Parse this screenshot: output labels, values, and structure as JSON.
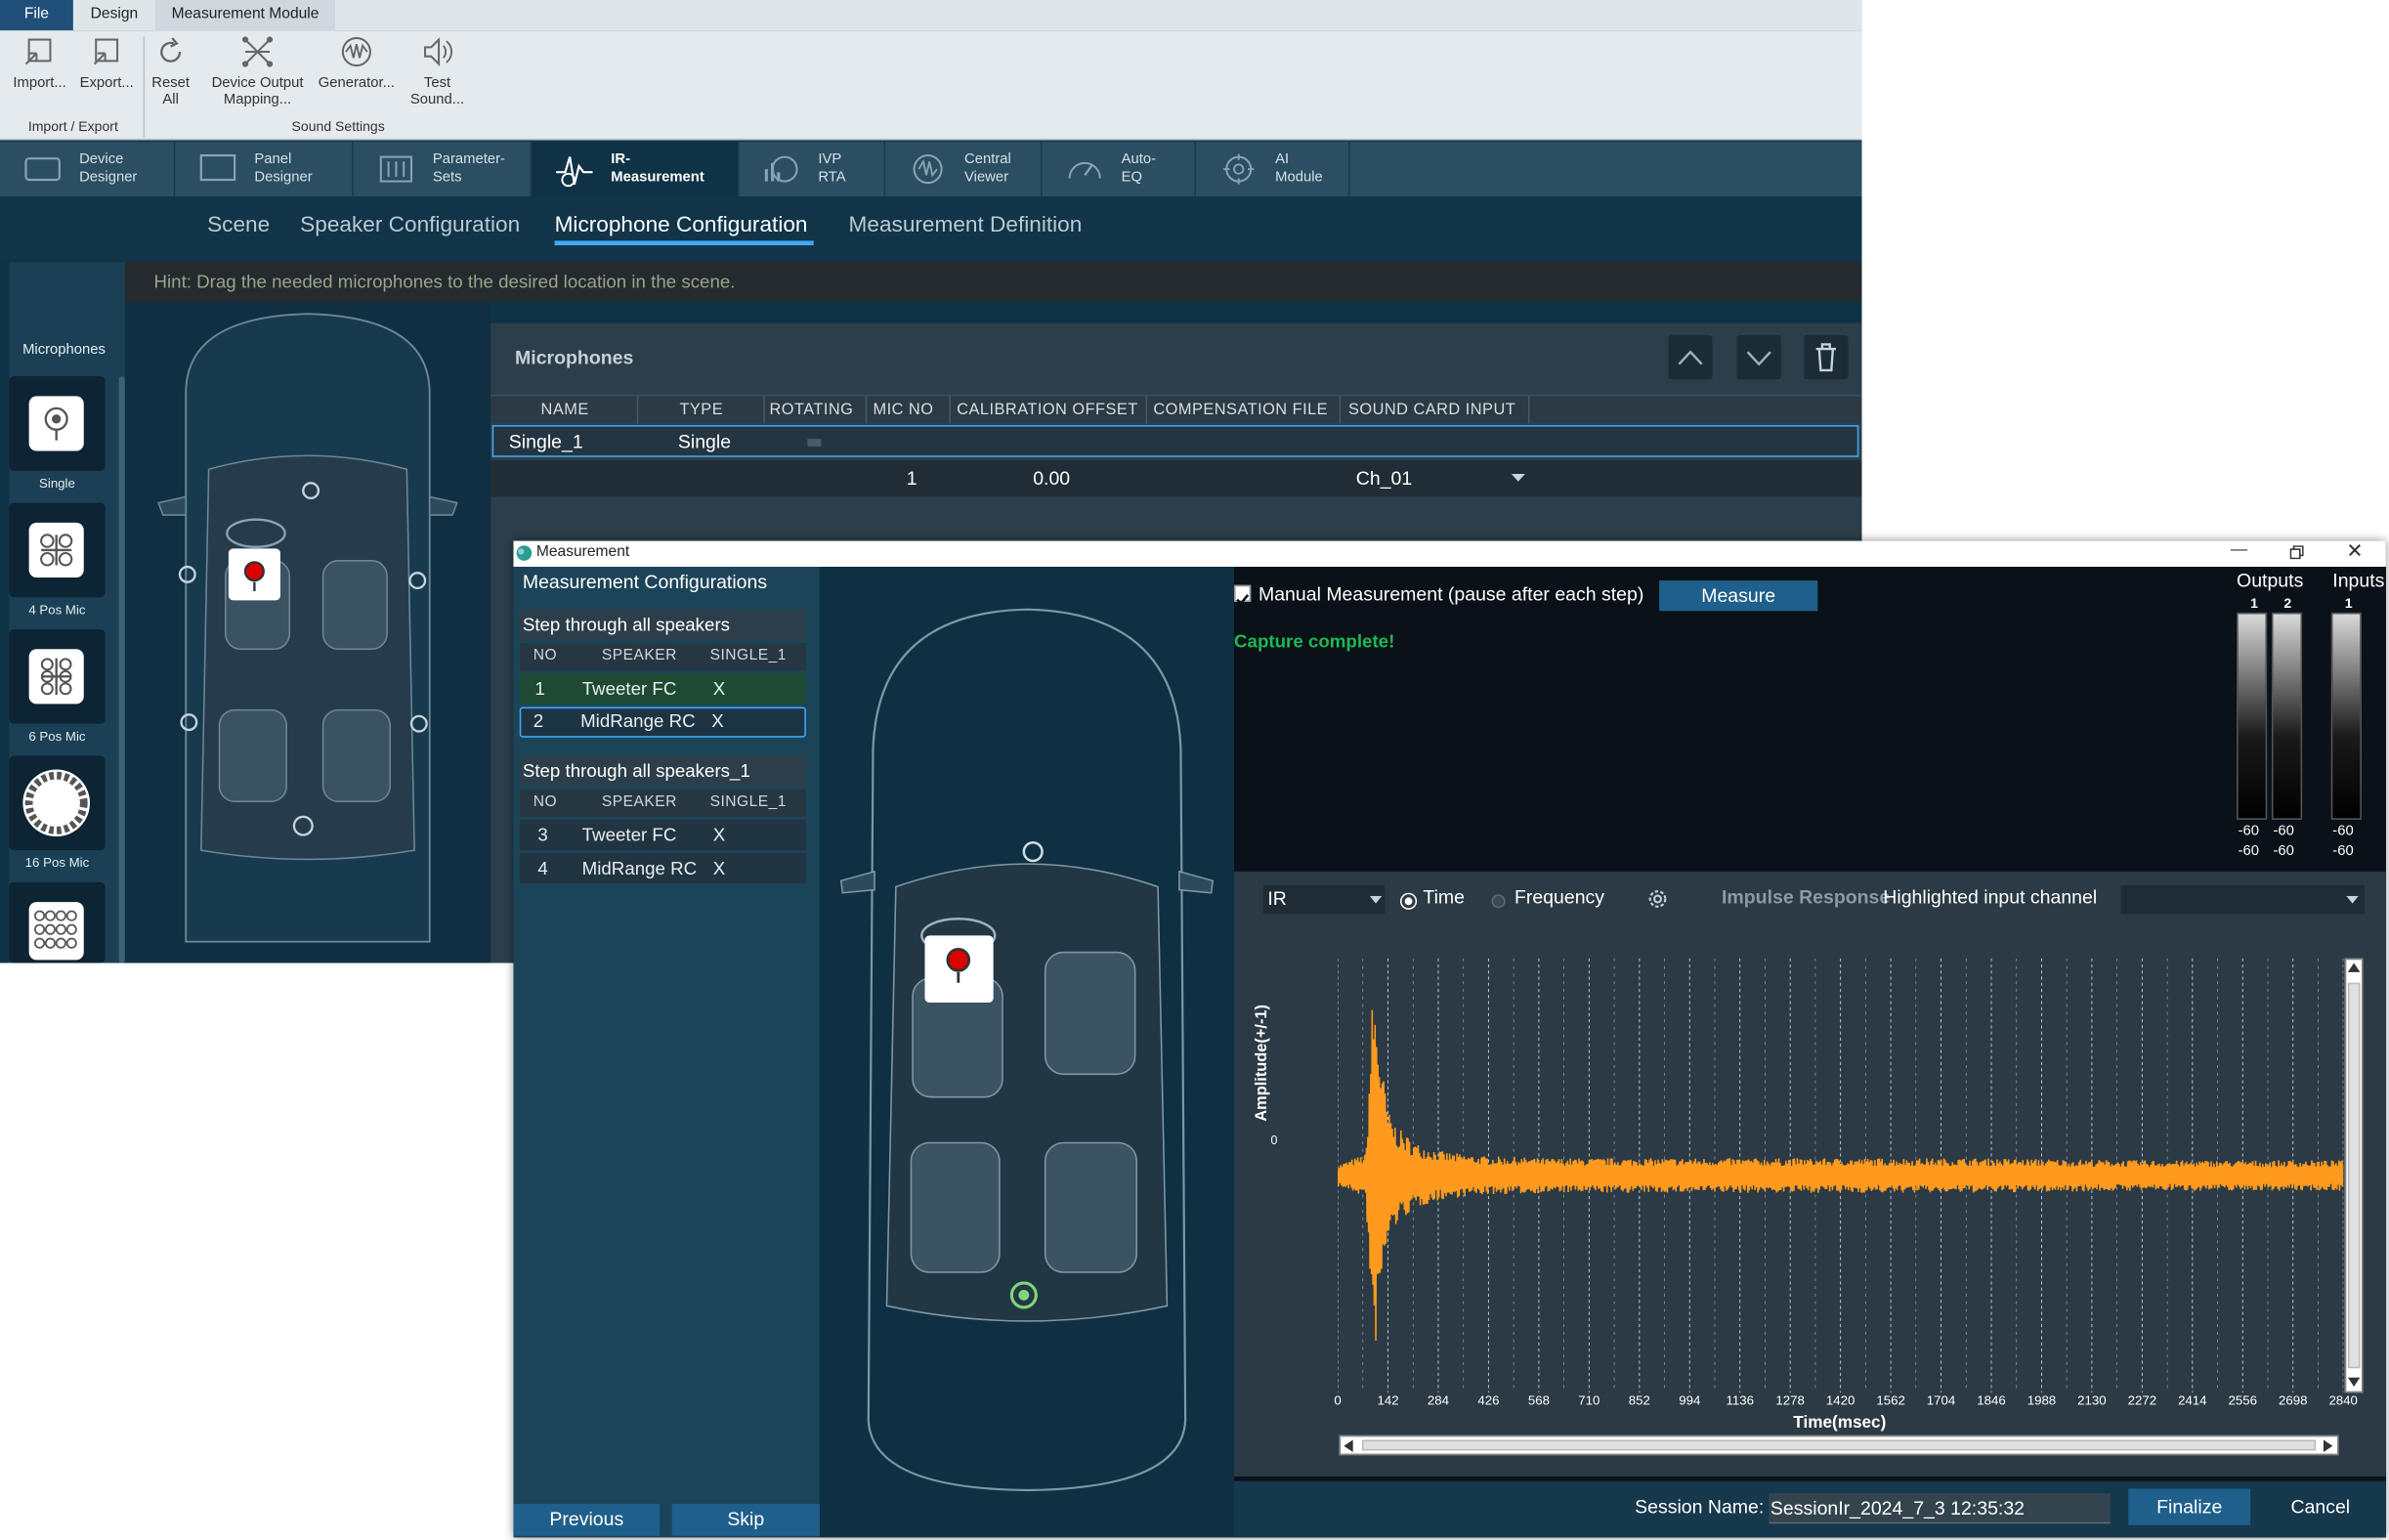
{
  "menu": {
    "file": "File",
    "design": "Design",
    "measurement_module": "Measurement Module"
  },
  "ribbon": {
    "import": "Import...",
    "export": "Export...",
    "reset": "Reset All",
    "device_output_mapping": "Device Output Mapping...",
    "generator": "Generator...",
    "test_sound": "Test Sound...",
    "group_import_export": "Import / Export",
    "group_sound_settings": "Sound Settings"
  },
  "modules": [
    {
      "label": "Device Designer"
    },
    {
      "label": "Panel Designer"
    },
    {
      "label": "Parameter-Sets"
    },
    {
      "label": "IR-Measurement"
    },
    {
      "label": "IVP RTA"
    },
    {
      "label": "Central Viewer"
    },
    {
      "label": "Auto-EQ"
    },
    {
      "label": "AI Module"
    }
  ],
  "subnav": {
    "scene": "Scene",
    "speaker_configuration": "Speaker Configuration",
    "microphone_configuration": "Microphone Configuration",
    "measurement_definition": "Measurement Definition"
  },
  "hint": "Hint: Drag the needed microphones to the desired location in the scene.",
  "palette": {
    "title": "Microphones",
    "items": [
      {
        "label": "Single"
      },
      {
        "label": "4 Pos Mic"
      },
      {
        "label": "6 Pos Mic"
      },
      {
        "label": "16 Pos Mic"
      }
    ]
  },
  "mic_panel": {
    "title": "Microphones",
    "columns": [
      "NAME",
      "TYPE",
      "ROTATING",
      "MIC NO",
      "CALIBRATION OFFSET",
      "COMPENSATION FILE",
      "SOUND CARD INPUT"
    ],
    "row": {
      "name": "Single_1",
      "type": "Single",
      "mic_no": "1",
      "calibration_offset": "0.00",
      "sound_card_input": "Ch_01"
    }
  },
  "dialog": {
    "title": "Measurement",
    "configurations_title": "Measurement Configurations",
    "groups": [
      {
        "title": "Step through all speakers",
        "columns": [
          "NO",
          "SPEAKER",
          "SINGLE_1"
        ],
        "rows": [
          {
            "no": "1",
            "speaker": "Tweeter FC",
            "value": "X"
          },
          {
            "no": "2",
            "speaker": "MidRange RC",
            "value": "X"
          }
        ]
      },
      {
        "title": "Step through all speakers_1",
        "columns": [
          "NO",
          "SPEAKER",
          "SINGLE_1"
        ],
        "rows": [
          {
            "no": "3",
            "speaker": "Tweeter FC",
            "value": "X"
          },
          {
            "no": "4",
            "speaker": "MidRange RC",
            "value": "X"
          }
        ]
      }
    ],
    "previous": "Previous",
    "skip": "Skip",
    "manual_measurement": "Manual Measurement (pause after each step)",
    "measure": "Measure",
    "status": "Capture complete!",
    "meters": {
      "outputs_label": "Outputs",
      "inputs_label": "Inputs",
      "outputs": [
        {
          "channel": "1",
          "peak": "-60",
          "rms": "-60"
        },
        {
          "channel": "2",
          "peak": "-60",
          "rms": "-60"
        }
      ],
      "inputs": [
        {
          "channel": "1",
          "peak": "-60",
          "rms": "-60"
        }
      ]
    },
    "plot": {
      "view_select": "IR",
      "time": "Time",
      "frequency": "Frequency",
      "impulse_response": "Impulse Response",
      "highlighted_channel": "Highlighted input channel"
    },
    "session_label": "Session Name:",
    "session_name": "SessionIr_2024_7_3 12:35:32",
    "finalize": "Finalize",
    "cancel": "Cancel"
  },
  "chart_data": {
    "type": "line",
    "xlabel": "Time(msec)",
    "ylabel": "Amplitude(+/-1)",
    "y_tick": "0",
    "x_ticks": [
      "0",
      "142",
      "284",
      "426",
      "568",
      "710",
      "852",
      "994",
      "1136",
      "1278",
      "1420",
      "1562",
      "1704",
      "1846",
      "1988",
      "2130",
      "2272",
      "2414",
      "2556",
      "2698",
      "2840"
    ],
    "xlim": [
      0,
      2840
    ],
    "ylim": [
      -1,
      1
    ],
    "grid": true,
    "series": [
      {
        "color": "#ff9a1f",
        "envelope": {
          "x": [
            0,
            80,
            100,
            130,
            142,
            170,
            220,
            300,
            400,
            600,
            900,
            1300,
            1800,
            2300,
            2840
          ],
          "amplitude": [
            0.05,
            0.1,
            0.9,
            0.45,
            0.3,
            0.22,
            0.15,
            0.11,
            0.09,
            0.08,
            0.08,
            0.08,
            0.08,
            0.07,
            0.07
          ]
        }
      }
    ]
  },
  "colors": {
    "accent": "#3fa9f5",
    "button": "#1f5f8b",
    "status_green": "#1db954",
    "ir_trace": "#ff9a1f"
  }
}
